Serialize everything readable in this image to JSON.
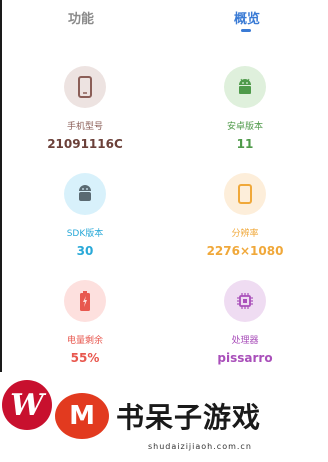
{
  "tabs": [
    {
      "label": "功能",
      "active": false
    },
    {
      "label": "概览",
      "active": true
    }
  ],
  "accent_color": "#3a7bd5",
  "cards": [
    {
      "icon": "phone-icon",
      "label": "手机型号",
      "value": "21091116C",
      "bg": "#ede3e1",
      "fg": "#8b5e57",
      "label_color": "#8b5e57",
      "value_color": "#6b4039"
    },
    {
      "icon": "android-icon",
      "label": "安卓版本",
      "value": "11",
      "bg": "#dff0dc",
      "fg": "#4f9a4a",
      "label_color": "#4f9a4a",
      "value_color": "#4f9a4a"
    },
    {
      "icon": "sdk-icon",
      "label": "SDK版本",
      "value": "30",
      "bg": "#d8f1fb",
      "fg": "#2aa9d8",
      "label_color": "#2aa9d8",
      "value_color": "#2aa9d8"
    },
    {
      "icon": "screen-icon",
      "label": "分辨率",
      "value": "2276×1080",
      "bg": "#fdeeda",
      "fg": "#f0a83a",
      "label_color": "#f0a83a",
      "value_color": "#f0a83a"
    },
    {
      "icon": "battery-icon",
      "label": "电量剩余",
      "value": "55%",
      "bg": "#fde0de",
      "fg": "#e8584f",
      "label_color": "#e8584f",
      "value_color": "#e8584f"
    },
    {
      "icon": "cpu-icon",
      "label": "处理器",
      "value": "pissarro",
      "bg": "#efdcf2",
      "fg": "#a94fba",
      "label_color": "#a94fba",
      "value_color": "#a94fba"
    }
  ],
  "watermark": {
    "logo_letter": "W",
    "m_letter": "M",
    "brand": "书呆子游戏",
    "url": "shudaizijiaoh.com.cn"
  }
}
